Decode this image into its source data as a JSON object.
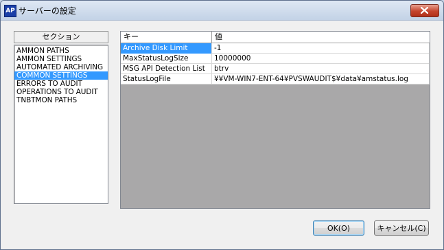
{
  "window": {
    "app_icon_text": "AP",
    "title": "サーバーの設定",
    "close_icon": "close-icon"
  },
  "sections": {
    "header": "セクション",
    "items": [
      {
        "label": "AMMON PATHS",
        "selected": false
      },
      {
        "label": "AMMON SETTINGS",
        "selected": false
      },
      {
        "label": "AUTOMATED ARCHIVING",
        "selected": false
      },
      {
        "label": "COMMON SETTINGS",
        "selected": true
      },
      {
        "label": "ERRORS TO AUDIT",
        "selected": false
      },
      {
        "label": "OPERATIONS TO AUDIT",
        "selected": false
      },
      {
        "label": "TNBTMON PATHS",
        "selected": false
      }
    ]
  },
  "grid": {
    "columns": {
      "key": "キー",
      "value": "値"
    },
    "rows": [
      {
        "key": "Archive Disk Limit",
        "value": "-1",
        "selected": true
      },
      {
        "key": "MaxStatusLogSize",
        "value": "10000000",
        "selected": false
      },
      {
        "key": "MSG API Detection List",
        "value": "btrv",
        "selected": false
      },
      {
        "key": "StatusLogFile",
        "value": "¥¥VM-WIN7-ENT-64¥PVSWAUDIT$¥data¥amstatus.log",
        "selected": false
      }
    ]
  },
  "buttons": {
    "ok": "OK(O)",
    "cancel": "キャンセル(C)"
  },
  "colors": {
    "selection": "#3399ff",
    "grid_background": "#a9a8a9",
    "close_button": "#c4442d"
  }
}
